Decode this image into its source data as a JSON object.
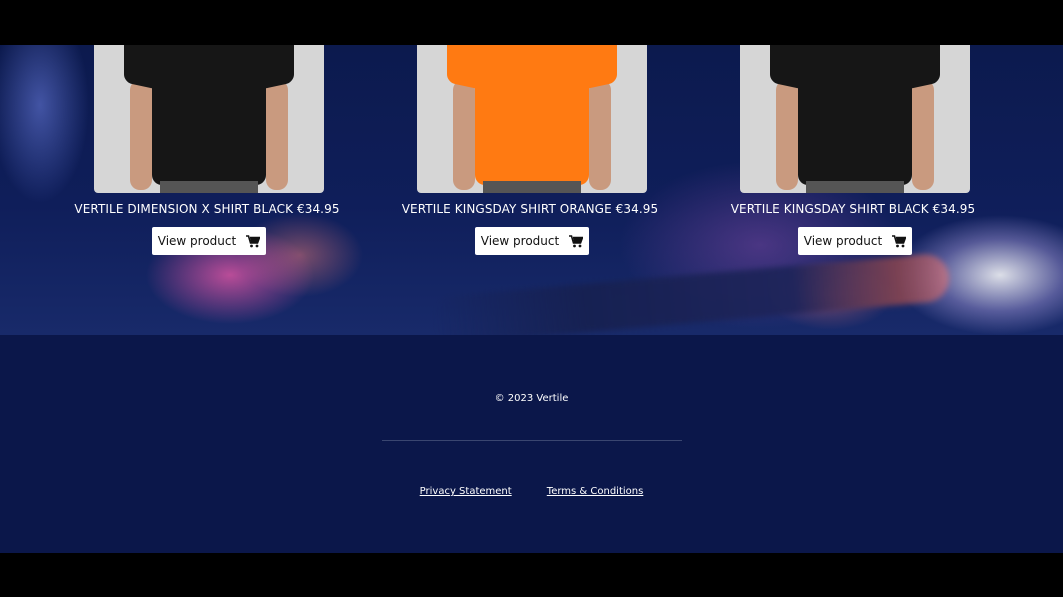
{
  "products": [
    {
      "title": "VERTILE DIMENSION X SHIRT BLACK €34.95",
      "button_label": "View product",
      "shirt_color": "#161616",
      "icon": "shopping-cart-icon"
    },
    {
      "title": "VERTILE KINGSDAY SHIRT ORANGE €34.95",
      "button_label": "View product",
      "shirt_color": "#ff7a12",
      "icon": "shopping-cart-icon"
    },
    {
      "title": "VERTILE KINGSDAY SHIRT BLACK €34.95",
      "button_label": "View product",
      "shirt_color": "#161616",
      "icon": "shopping-cart-icon"
    }
  ],
  "footer": {
    "copyright": "© 2023 Vertile",
    "links": {
      "privacy": "Privacy Statement",
      "terms": "Terms & Conditions"
    },
    "background": "#0b174a"
  }
}
